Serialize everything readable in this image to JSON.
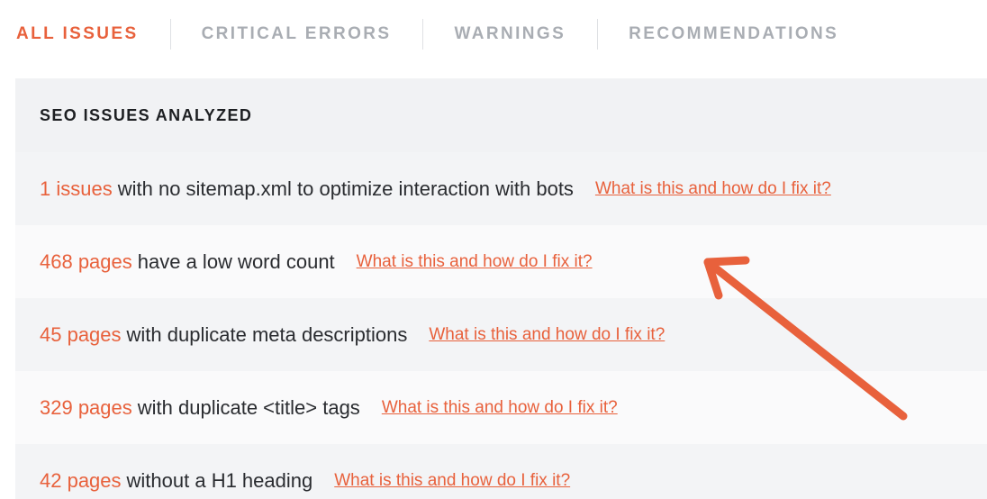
{
  "tabs": [
    {
      "label": "ALL ISSUES",
      "active": true
    },
    {
      "label": "CRITICAL ERRORS",
      "active": false
    },
    {
      "label": "WARNINGS",
      "active": false
    },
    {
      "label": "RECOMMENDATIONS",
      "active": false
    }
  ],
  "panel": {
    "title": "SEO ISSUES ANALYZED",
    "rows": [
      {
        "count": "1 issues",
        "text": "with no sitemap.xml to optimize interaction with bots",
        "link": "What is this and how do I fix it?"
      },
      {
        "count": "468 pages",
        "text": "have a low word count",
        "link": "What is this and how do I fix it?"
      },
      {
        "count": "45 pages",
        "text": "with duplicate meta descriptions",
        "link": "What is this and how do I fix it?"
      },
      {
        "count": "329 pages",
        "text": "with duplicate <title> tags",
        "link": "What is this and how do I fix it?"
      },
      {
        "count": "42 pages",
        "text": "without a H1 heading",
        "link": "What is this and how do I fix it?"
      }
    ]
  },
  "colors": {
    "accent": "#e8613c",
    "tab_inactive": "#a9adb3",
    "header_bg": "#f1f2f4"
  },
  "annotation": {
    "icon": "arrow-icon"
  }
}
